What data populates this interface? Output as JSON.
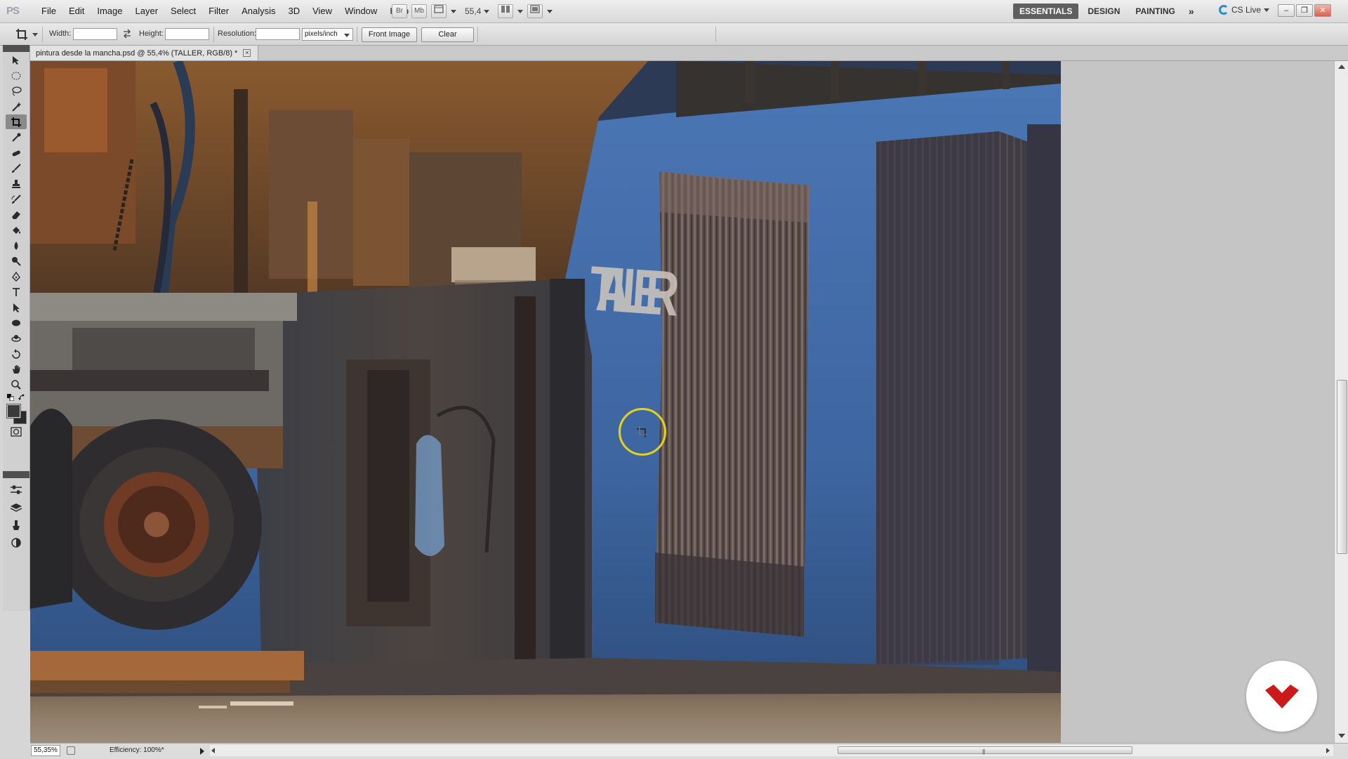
{
  "app": {
    "logo_text": "PS",
    "menu": [
      "File",
      "Edit",
      "Image",
      "Layer",
      "Select",
      "Filter",
      "Analysis",
      "3D",
      "View",
      "Window",
      "Help"
    ],
    "bridge_label": "Br",
    "minibridge_label": "Mb",
    "zoom_value": "55,4",
    "workspaces": {
      "items": [
        "ESSENTIALS",
        "DESIGN",
        "PAINTING"
      ],
      "active": "ESSENTIALS",
      "more_icon": "double-chevron-right-icon"
    },
    "cs_live_label": "CS Live"
  },
  "options_bar": {
    "tool_icon": "crop-icon",
    "width_label": "Width:",
    "width_value": "",
    "height_label": "Height:",
    "height_value": "",
    "resolution_label": "Resolution:",
    "resolution_value": "",
    "resolution_unit": "pixels/inch",
    "front_image_label": "Front Image",
    "clear_label": "Clear"
  },
  "document": {
    "tab_title": "pintura desde la mancha.psd @ 55,4% (TALLER, RGB/8) *",
    "painting_sign_text": "TALLER"
  },
  "toolbox": {
    "active_tool": "crop-tool",
    "tools": [
      "move-tool",
      "marquee-tool",
      "lasso-tool",
      "quick-selection-tool",
      "crop-tool",
      "eyedropper-tool",
      "spot-healing-tool",
      "brush-tool",
      "clone-stamp-tool",
      "history-brush-tool",
      "eraser-tool",
      "paint-bucket-tool",
      "blur-tool",
      "dodge-tool",
      "pen-tool",
      "type-tool",
      "path-selection-tool",
      "ellipse-tool",
      "3d-rotate-tool",
      "3d-orbit-tool",
      "hand-tool",
      "zoom-tool"
    ]
  },
  "status_bar": {
    "zoom": "55,35%",
    "info": "Efficiency: 100%*"
  },
  "colors": {
    "cursor_ring": "#e5d21c",
    "brand_mark": "#cc1a1a",
    "active_workspace": "#5f5f5f",
    "sky_blue": "#3f6aa6"
  }
}
